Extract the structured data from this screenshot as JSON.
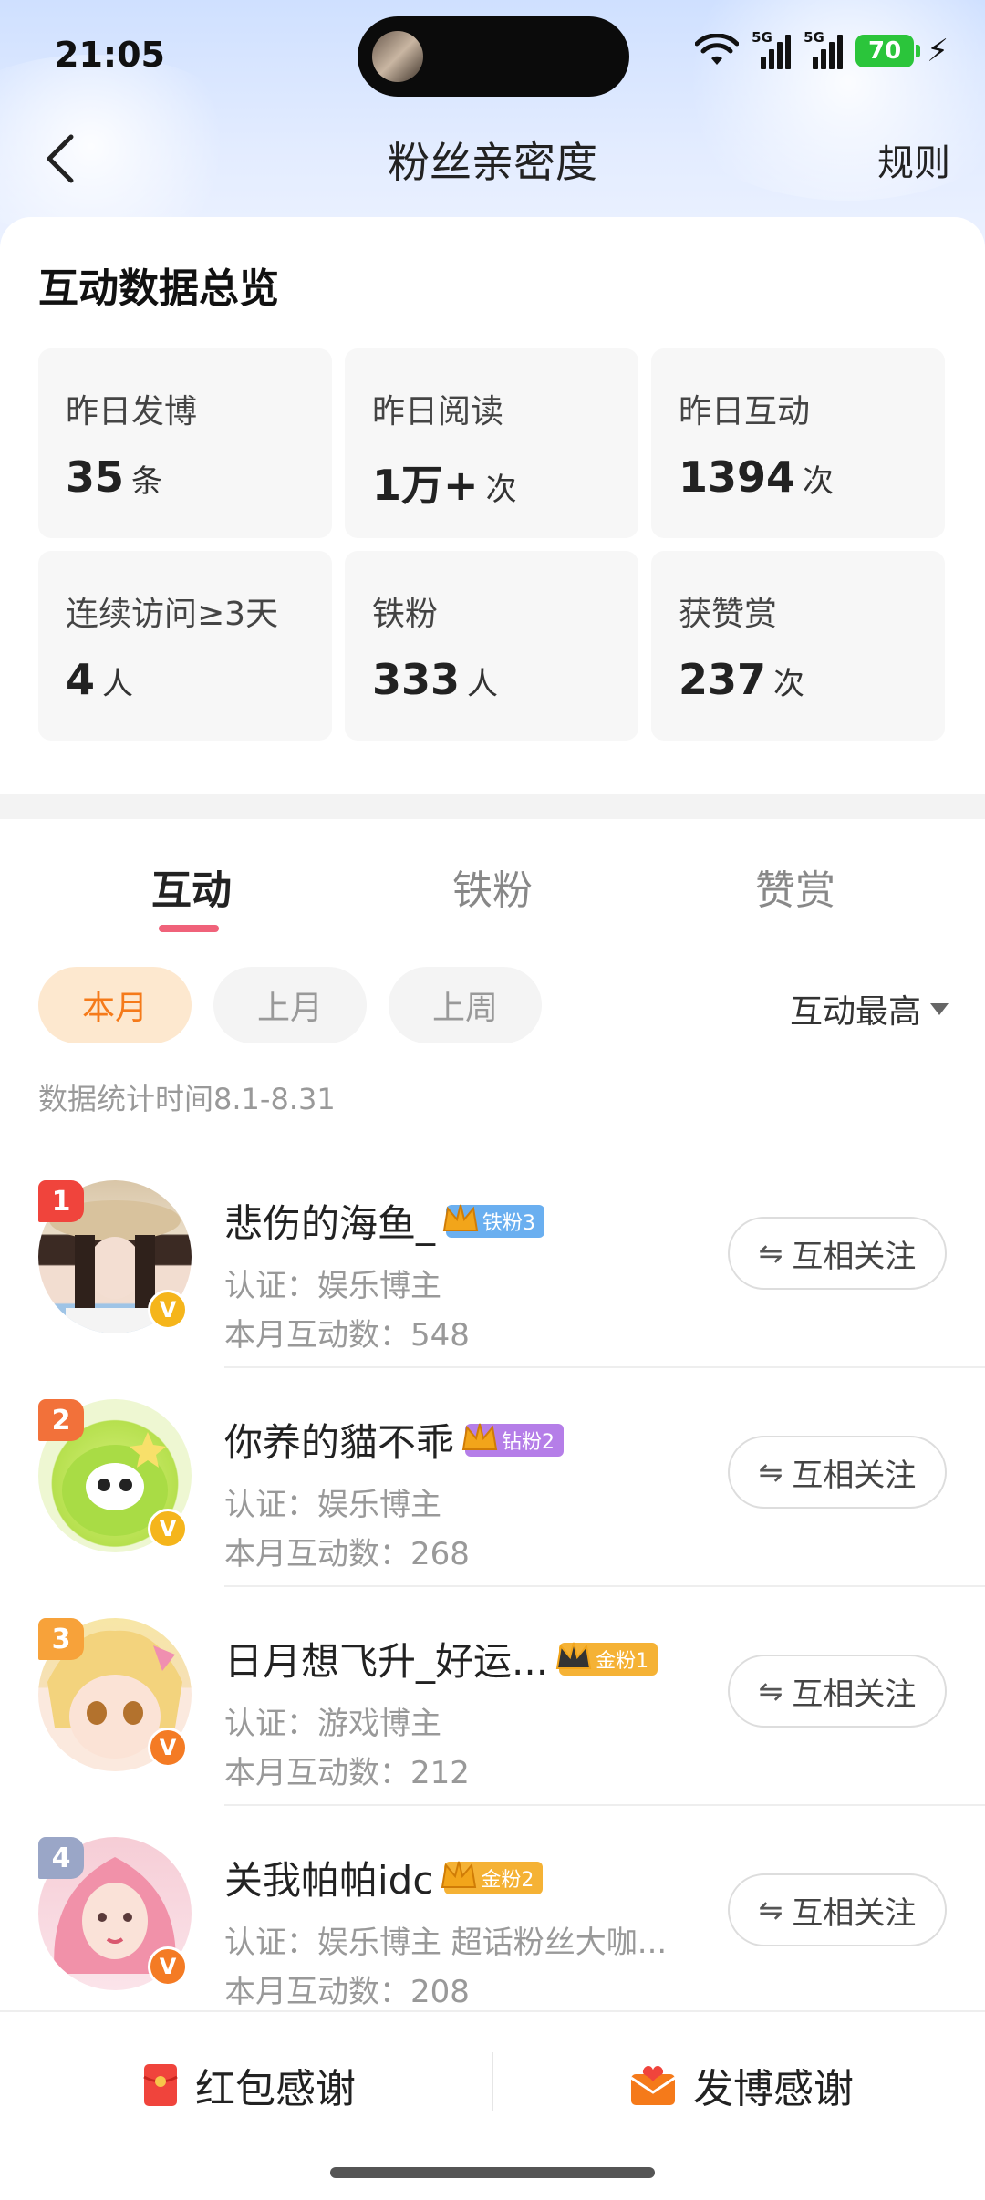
{
  "status_bar": {
    "time": "21:05",
    "battery": "70",
    "signal_1": "5G",
    "signal_2": "5G"
  },
  "nav": {
    "title": "粉丝亲密度",
    "rules": "规则"
  },
  "overview": {
    "title": "互动数据总览",
    "stats": [
      {
        "label": "昨日发博",
        "value": "35",
        "unit": "条"
      },
      {
        "label": "昨日阅读",
        "value": "1万+",
        "unit": "次"
      },
      {
        "label": "昨日互动",
        "value": "1394",
        "unit": "次"
      },
      {
        "label": "连续访问≥3天",
        "value": "4",
        "unit": "人"
      },
      {
        "label": "铁粉",
        "value": "333",
        "unit": "人"
      },
      {
        "label": "获赞赏",
        "value": "237",
        "unit": "次"
      }
    ]
  },
  "tabs": [
    {
      "label": "互动"
    },
    {
      "label": "铁粉"
    },
    {
      "label": "赞赏"
    }
  ],
  "filters": {
    "chips": [
      "本月",
      "上月",
      "上周"
    ],
    "sort_label": "互动最高"
  },
  "stat_time": "数据统计时间8.1-8.31",
  "fans": [
    {
      "rank": "1",
      "name": "悲伤的海鱼_",
      "level": "铁粉3",
      "cert": "认证：娱乐博主",
      "count": "本月互动数：548",
      "button": "互相关注"
    },
    {
      "rank": "2",
      "name": "你养的貓不乖",
      "level": "钻粉2",
      "cert": "认证：娱乐博主",
      "count": "本月互动数：268",
      "button": "互相关注"
    },
    {
      "rank": "3",
      "name": "日月想飞升_好运...",
      "level": "金粉1",
      "cert": "认证：游戏博主",
      "count": "本月互动数：212",
      "button": "互相关注"
    },
    {
      "rank": "4",
      "name": "关我帕帕idc",
      "level": "金粉2",
      "cert": "认证：娱乐博主 超话粉丝大咖...",
      "count": "本月互动数：208",
      "button": "互相关注"
    }
  ],
  "bottom": {
    "red_packet": "红包感谢",
    "post_thanks": "发博感谢"
  },
  "colors": {
    "accent": "#f0627a",
    "chip_active_bg": "#fde8cf",
    "chip_active_text": "#f57a1a",
    "rank_1": "#f0443c",
    "rank_2": "#f2713a",
    "rank_3": "#f7a23a",
    "rank_4": "#9aa6c7"
  },
  "icons": {
    "back": "chevron-left-icon",
    "mutual": "swap-arrows-icon",
    "red_packet": "red-packet-icon",
    "post": "envelope-heart-icon",
    "sort": "caret-down-icon"
  }
}
